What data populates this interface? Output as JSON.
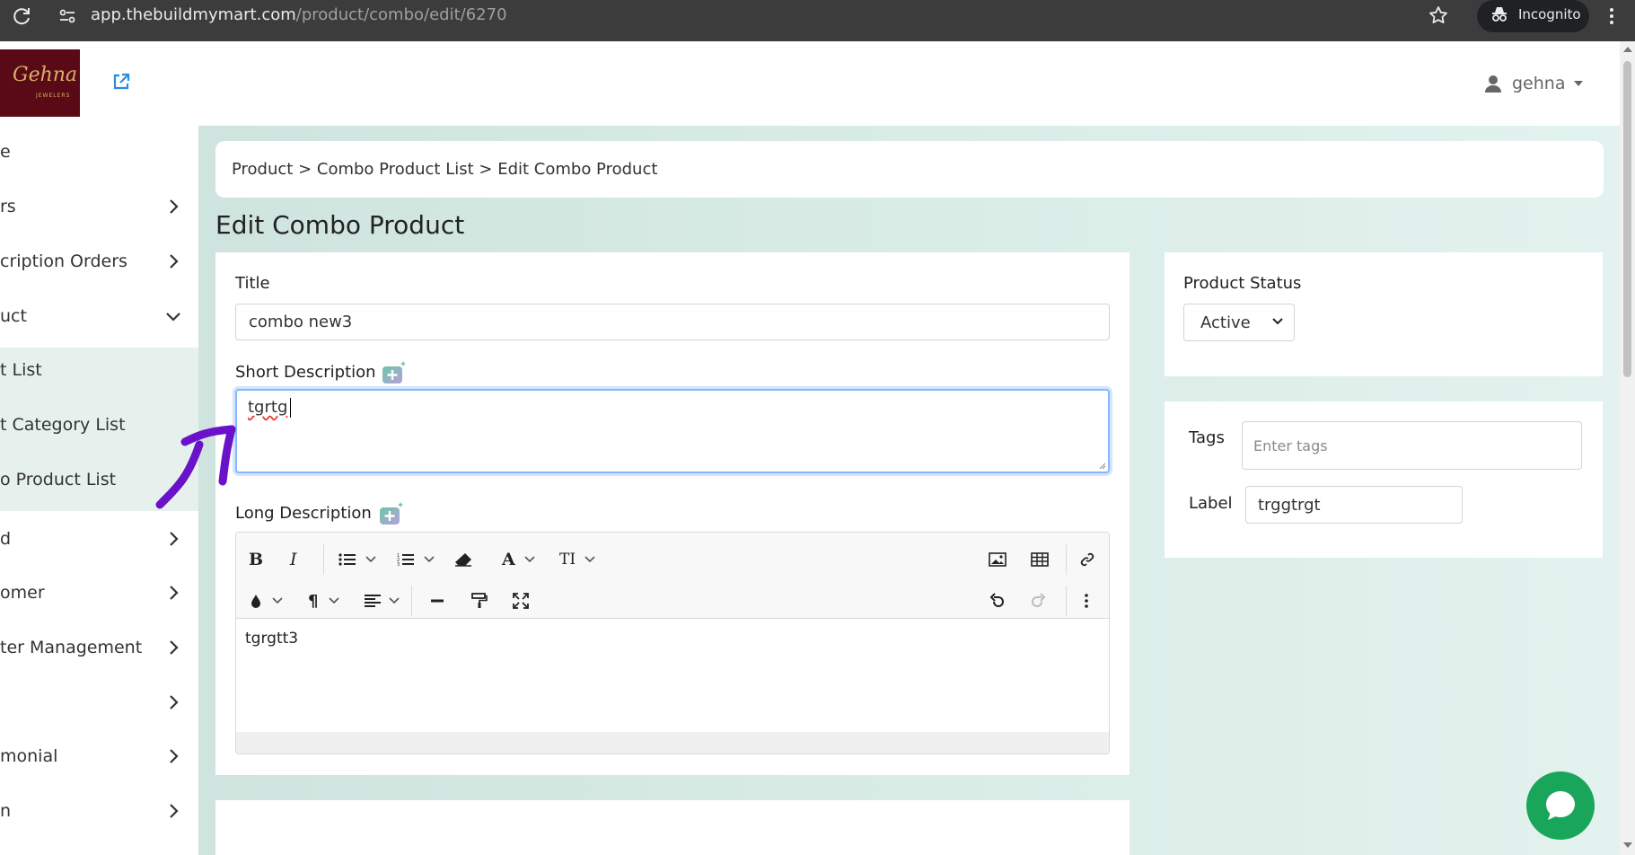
{
  "browser": {
    "url_host": "app.thebuildmymart.com",
    "url_path": "/product/combo/edit/6270",
    "incognito_label": "Incognito"
  },
  "header": {
    "logo_text": "Gehna",
    "logo_subtext": "JEWELERS",
    "username": "gehna"
  },
  "sidebar": {
    "items": [
      {
        "label": "e"
      },
      {
        "label": "rs"
      },
      {
        "label": "cription Orders"
      },
      {
        "label": "uct"
      },
      {
        "label": "t List"
      },
      {
        "label": "t Category List"
      },
      {
        "label": "o Product List"
      },
      {
        "label": "d"
      },
      {
        "label": "omer"
      },
      {
        "label": "ter Management"
      },
      {
        "label": ""
      },
      {
        "label": "monial"
      },
      {
        "label": "n"
      }
    ]
  },
  "breadcrumb": "Product > Combo Product List > Edit Combo Product",
  "page_title": "Edit Combo Product",
  "form": {
    "title_label": "Title",
    "title_value": "combo new3",
    "short_desc_label": "Short Description",
    "short_desc_value": "tgrtg",
    "long_desc_label": "Long Description",
    "long_desc_value": "tgrgtt3",
    "toolbar": {
      "bold": "B",
      "italic": "I",
      "font": "A",
      "text_size": "TI",
      "paragraph": "¶"
    }
  },
  "status": {
    "label": "Product Status",
    "value": "Active"
  },
  "tags": {
    "tags_label": "Tags",
    "tags_placeholder": "Enter tags",
    "label_label": "Label",
    "label_value": "trggtrgt"
  },
  "colors": {
    "accent": "#19a65a",
    "focus_border": "#86b7fe",
    "content_bg": "#d9ece6",
    "logo_bg": "#5a0a17",
    "annotation": "#6a12c9"
  }
}
